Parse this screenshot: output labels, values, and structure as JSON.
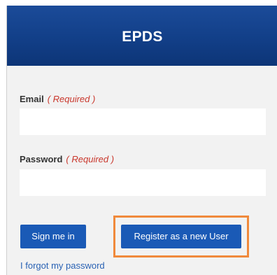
{
  "header": {
    "title": "EPDS"
  },
  "form": {
    "email_label": "Email",
    "email_required": "( Required )",
    "email_value": "",
    "password_label": "Password",
    "password_required": "( Required )",
    "password_value": ""
  },
  "actions": {
    "signin_label": "Sign me in",
    "register_label": "Register as a new User",
    "forgot_label": "I forgot my password"
  },
  "colors": {
    "header_bg": "#123f88",
    "button_bg": "#1a5ab6",
    "required_text": "#c9372c",
    "highlight_border": "#f08a3c",
    "link": "#2a62b4"
  }
}
